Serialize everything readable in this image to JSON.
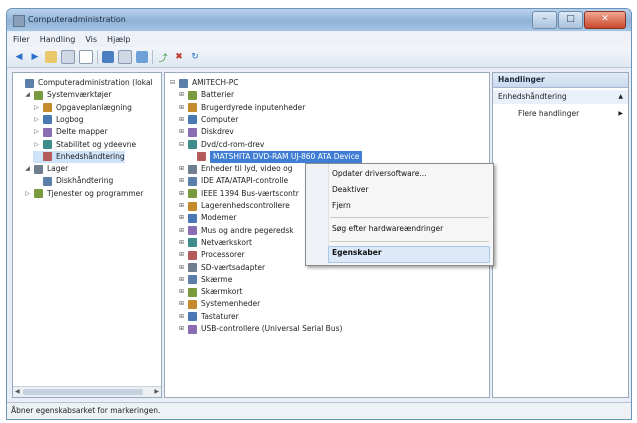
{
  "window": {
    "title": "Computeradministration"
  },
  "menubar": [
    "Filer",
    "Handling",
    "Vis",
    "Hjælp"
  ],
  "left_tree": [
    {
      "label": "Computeradministration (lokal",
      "icon": "computer-management-icon",
      "indent": 0,
      "exp": ""
    },
    {
      "label": "Systemværktøjer",
      "icon": "tools-icon",
      "indent": 1,
      "exp": "◢"
    },
    {
      "label": "Opgaveplanlægning",
      "icon": "clock-icon",
      "indent": 2,
      "exp": "▷"
    },
    {
      "label": "Logbog",
      "icon": "event-viewer-icon",
      "indent": 2,
      "exp": "▷"
    },
    {
      "label": "Delte mapper",
      "icon": "shared-folder-icon",
      "indent": 2,
      "exp": "▷"
    },
    {
      "label": "Stabilitet og ydeevne",
      "icon": "performance-icon",
      "indent": 2,
      "exp": "▷"
    },
    {
      "label": "Enhedshåndtering",
      "icon": "device-manager-icon",
      "indent": 2,
      "exp": "",
      "selected": true
    },
    {
      "label": "Lager",
      "icon": "storage-icon",
      "indent": 1,
      "exp": "◢"
    },
    {
      "label": "Diskhåndtering",
      "icon": "disk-icon",
      "indent": 2,
      "exp": ""
    },
    {
      "label": "Tjenester og programmer",
      "icon": "services-icon",
      "indent": 1,
      "exp": "▷"
    }
  ],
  "device_tree": [
    {
      "label": "AMITECH-PC",
      "icon": "computer-icon",
      "indent": 0,
      "exp": "⊟"
    },
    {
      "label": "Batterier",
      "icon": "battery-icon",
      "indent": 1,
      "exp": "⊞"
    },
    {
      "label": "Brugerdyrede inputenheder",
      "icon": "hid-icon",
      "indent": 1,
      "exp": "⊞"
    },
    {
      "label": "Computer",
      "icon": "computer-icon",
      "indent": 1,
      "exp": "⊞"
    },
    {
      "label": "Diskdrev",
      "icon": "disk-drive-icon",
      "indent": 1,
      "exp": "⊞"
    },
    {
      "label": "Dvd/cd-rom-drev",
      "icon": "cdrom-icon",
      "indent": 1,
      "exp": "⊟"
    },
    {
      "label": "MATSHITA DVD-RAM UJ-860 ATA Device",
      "icon": "cdrom-device-icon",
      "indent": 2,
      "exp": "",
      "selected": true
    },
    {
      "label": "Enheder til lyd, video og",
      "icon": "sound-icon",
      "indent": 1,
      "exp": "⊞"
    },
    {
      "label": "IDE ATA/ATAPI-controlle",
      "icon": "ide-icon",
      "indent": 1,
      "exp": "⊞"
    },
    {
      "label": "IEEE 1394 Bus-værtscontr",
      "icon": "firewire-icon",
      "indent": 1,
      "exp": "⊞"
    },
    {
      "label": "Lagerenhedscontrollere",
      "icon": "storage-controller-icon",
      "indent": 1,
      "exp": "⊞"
    },
    {
      "label": "Modemer",
      "icon": "modem-icon",
      "indent": 1,
      "exp": "⊞"
    },
    {
      "label": "Mus og andre pegeredsk",
      "icon": "mouse-icon",
      "indent": 1,
      "exp": "⊞"
    },
    {
      "label": "Netværkskort",
      "icon": "network-icon",
      "indent": 1,
      "exp": "⊞"
    },
    {
      "label": "Processorer",
      "icon": "cpu-icon",
      "indent": 1,
      "exp": "⊞"
    },
    {
      "label": "SD-værtsadapter",
      "icon": "sd-icon",
      "indent": 1,
      "exp": "⊞"
    },
    {
      "label": "Skærme",
      "icon": "monitor-icon",
      "indent": 1,
      "exp": "⊞"
    },
    {
      "label": "Skærmkort",
      "icon": "display-adapter-icon",
      "indent": 1,
      "exp": "⊞"
    },
    {
      "label": "Systemenheder",
      "icon": "system-icon",
      "indent": 1,
      "exp": "⊞"
    },
    {
      "label": "Tastaturer",
      "icon": "keyboard-icon",
      "indent": 1,
      "exp": "⊞"
    },
    {
      "label": "USB-controllere (Universal Serial Bus)",
      "icon": "usb-icon",
      "indent": 1,
      "exp": "⊞"
    }
  ],
  "actions": {
    "header": "Handlinger",
    "section": "Enhedshåndtering",
    "more": "Flere handlinger"
  },
  "context_menu": [
    "Opdater driversoftware...",
    "Deaktiver",
    "Fjern",
    "Søg efter hardwareændringer",
    "Egenskaber"
  ],
  "status": "Åbner egenskabsarket for markeringen."
}
